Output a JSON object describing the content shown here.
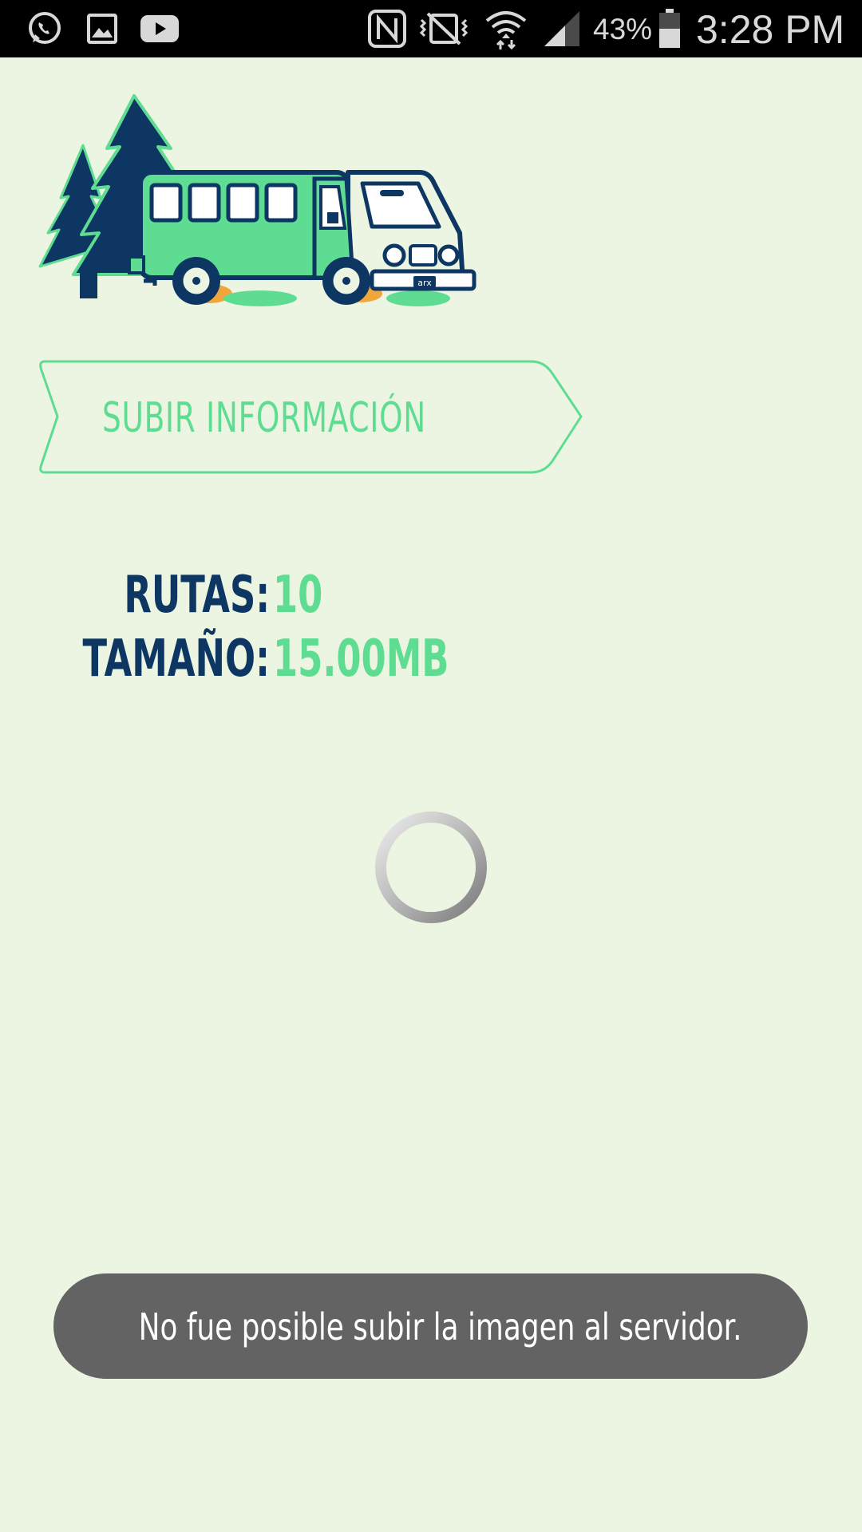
{
  "status_bar": {
    "left_icons": [
      "whatsapp-icon",
      "gallery-icon",
      "youtube-icon"
    ],
    "right_icons": [
      "nfc-icon",
      "vibrate-icon",
      "wifi-icon",
      "signal-icon",
      "battery-icon"
    ],
    "battery_percent": "43%",
    "time": "3:28 PM"
  },
  "logo": {
    "icon": "bus-and-trees-logo",
    "plate_text": "arx"
  },
  "upload_button": {
    "label": "SUBIR INFORMACIÓN"
  },
  "stats": {
    "routes_label": "RUTAS:",
    "routes_value": "10",
    "size_label": "TAMAÑO:",
    "size_value": "15.00MB"
  },
  "loading": {
    "icon": "loading-spinner"
  },
  "toast": {
    "message": "No fue posible subir la imagen al servidor."
  },
  "colors": {
    "background": "#ecf4e2",
    "accent_green": "#5edc91",
    "navy": "#0d3663",
    "toast_bg": "#636363"
  }
}
